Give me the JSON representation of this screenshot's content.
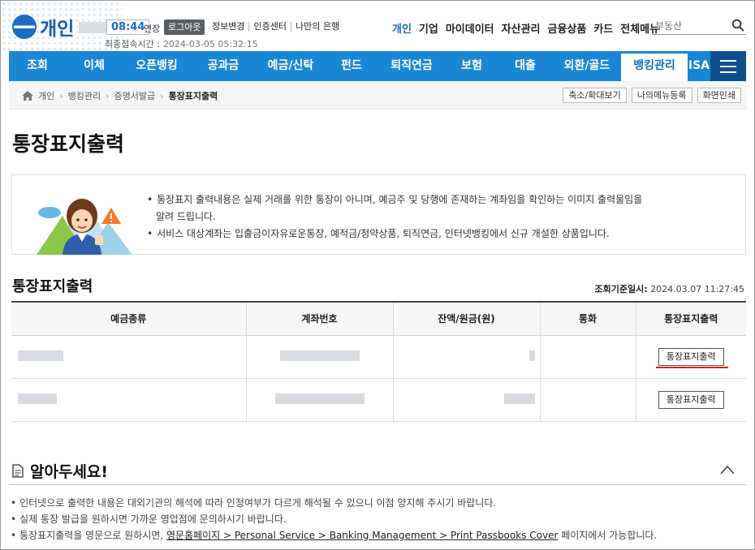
{
  "header": {
    "brand": "개인",
    "timer": "08:44",
    "extend": "연장",
    "logout": "로그아웃",
    "links": [
      "정보변경",
      "인증센터",
      "나만의 은행"
    ],
    "last_login_label": "최종접속시간 :",
    "last_login_value": "2024-03-05 05:32:15",
    "main_links": [
      "개인",
      "기업",
      "마이데이터",
      "자산관리",
      "금융상품",
      "카드",
      "전체메뉴"
    ],
    "search_placeholder": "부동산"
  },
  "nav": {
    "items": [
      "조회",
      "이체",
      "오픈뱅킹",
      "공과금",
      "예금/신탁",
      "펀드",
      "퇴직연금",
      "보험",
      "대출",
      "외환/골드",
      "뱅킹관리",
      "ISA"
    ],
    "selected": "뱅킹관리"
  },
  "breadcrumb": {
    "items": [
      "개인",
      "뱅킹관리",
      "증명서발급",
      "통장표지출력"
    ],
    "buttons": [
      "축소/확대보기",
      "나의메뉴등록",
      "화면인쇄"
    ]
  },
  "page": {
    "title": "통장표지출력",
    "info": [
      "통장표지 출력내용은 실제 거래를 위한 통장이 아니며, 예금주 및 당행에 존재하는 계좌임을 확인하는 이미지 출력물임을",
      "알려 드립니다.",
      "서비스 대상계좌는 입출금이자유로운통장, 예적금/청약상품, 퇴직연금, 인터넷뱅킹에서 신규 개설한 상품입니다."
    ],
    "subtitle": "통장표지출력",
    "base_date_label": "조회기준일시:",
    "base_date_value": "2024.03.07 11:27:45"
  },
  "table": {
    "headers": [
      "예금종류",
      "계좌번호",
      "잔액/원금(원)",
      "통화",
      "통장표지출력"
    ],
    "rows": [
      {
        "print_label": "통장표지출력"
      },
      {
        "print_label": "통장표지출력"
      }
    ]
  },
  "notice": {
    "title": "알아두세요!",
    "items": [
      "인터넷으로 출력한 내용은 대외기관의 해석에 따라 인정여부가 다르게 해석될 수 있으니 이점 양지해 주시기 바랍니다.",
      "실제 통장 발급을 원하시면 가까운 영업점에 문의하시기 바랍니다."
    ],
    "item3_prefix": "통장표지출력을 영문으로 원하시면, ",
    "item3_link": "영문홈페이지 > Personal Service > Banking Management > Print Passbooks Cover",
    "item3_suffix": " 페이지에서 가능합니다."
  },
  "colors": {
    "nav_blue": "#1a86d6",
    "accent": "#1a6cc4",
    "highlight_red": "#d9231b"
  }
}
